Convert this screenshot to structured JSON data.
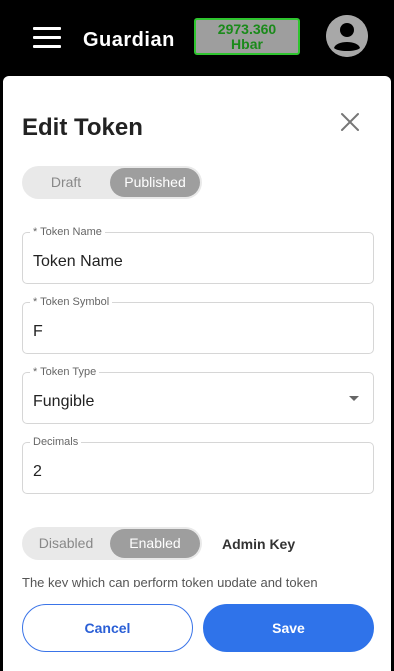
{
  "header": {
    "app_title": "Guardian",
    "balance_amount": "2973.360",
    "balance_unit": "Hbar",
    "menu_icon": "hamburger-menu-icon",
    "avatar_icon": "account-circle-icon"
  },
  "dialog": {
    "title": "Edit Token",
    "close_icon": "close-icon",
    "status_toggle": {
      "options": [
        "Draft",
        "Published"
      ],
      "selected": "Published"
    },
    "fields": {
      "token_name": {
        "label": "* Token Name",
        "value": "Token Name"
      },
      "token_symbol": {
        "label": "* Token Symbol",
        "value": "F"
      },
      "token_type": {
        "label": "* Token Type",
        "value": "Fungible"
      },
      "decimals": {
        "label": "Decimals",
        "value": "2"
      }
    },
    "admin_key": {
      "options": [
        "Disabled",
        "Enabled"
      ],
      "selected": "Enabled",
      "label": "Admin Key",
      "description": "The key which can perform token update and token"
    },
    "buttons": {
      "cancel": "Cancel",
      "save": "Save"
    }
  },
  "colors": {
    "accent": "#2f73ea",
    "balance_border": "#2fc52f",
    "toggle_active": "#9e9e9e"
  }
}
